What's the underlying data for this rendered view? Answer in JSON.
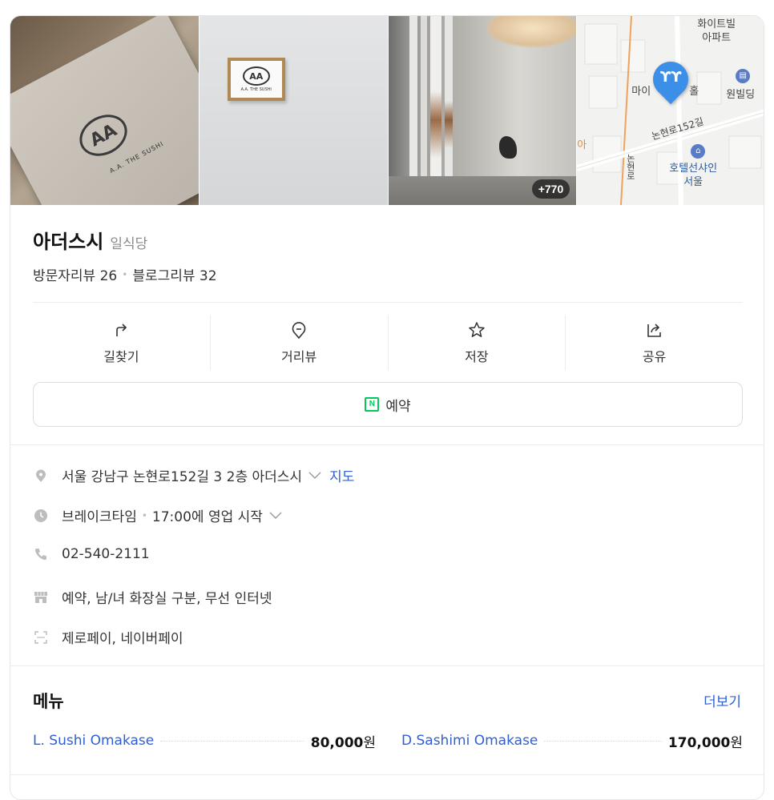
{
  "photos": {
    "count_badge": "+770",
    "photo1_logo": "AA",
    "photo1_sub": "A.A. THE SUSHI",
    "photo2_logo": "AA",
    "photo2_sub": "A.A. THE SUSHI",
    "map_labels": {
      "top": "화이트빌\n아파트",
      "left": "마이",
      "mid": "홀",
      "right": "원빌딩",
      "road": "논현로152길",
      "hotel": "호텔선샤인\n서울",
      "side_left": "아",
      "vertical": "논현로"
    }
  },
  "place": {
    "name": "아더스시",
    "category": "일식당",
    "visitor_reviews": "방문자리뷰 26",
    "blog_reviews": "블로그리뷰 32"
  },
  "actions": [
    {
      "label": "길찾기",
      "icon": "directions-icon"
    },
    {
      "label": "거리뷰",
      "icon": "street-view-icon"
    },
    {
      "label": "저장",
      "icon": "star-icon"
    },
    {
      "label": "공유",
      "icon": "share-icon"
    }
  ],
  "reserve": {
    "badge": "N",
    "label": "예약"
  },
  "info": {
    "address": "서울 강남구 논현로152길 3 2층 아더스시",
    "map_link": "지도",
    "status": "브레이크타임",
    "hours": "17:00에 영업 시작",
    "phone": "02-540-2111",
    "amenities": "예약, 남/녀 화장실 구분, 무선 인터넷",
    "payments": "제로페이, 네이버페이"
  },
  "menu": {
    "title": "메뉴",
    "more": "더보기",
    "items": [
      {
        "name": "L. Sushi Omakase",
        "price_num": "80,000",
        "price_unit": "원"
      },
      {
        "name": "D.Sashimi Omakase",
        "price_num": "170,000",
        "price_unit": "원"
      }
    ]
  },
  "colors": {
    "accent_link": "#2e5fd6",
    "naver_green": "#03c75a",
    "pin_blue": "#3b8fe6"
  }
}
